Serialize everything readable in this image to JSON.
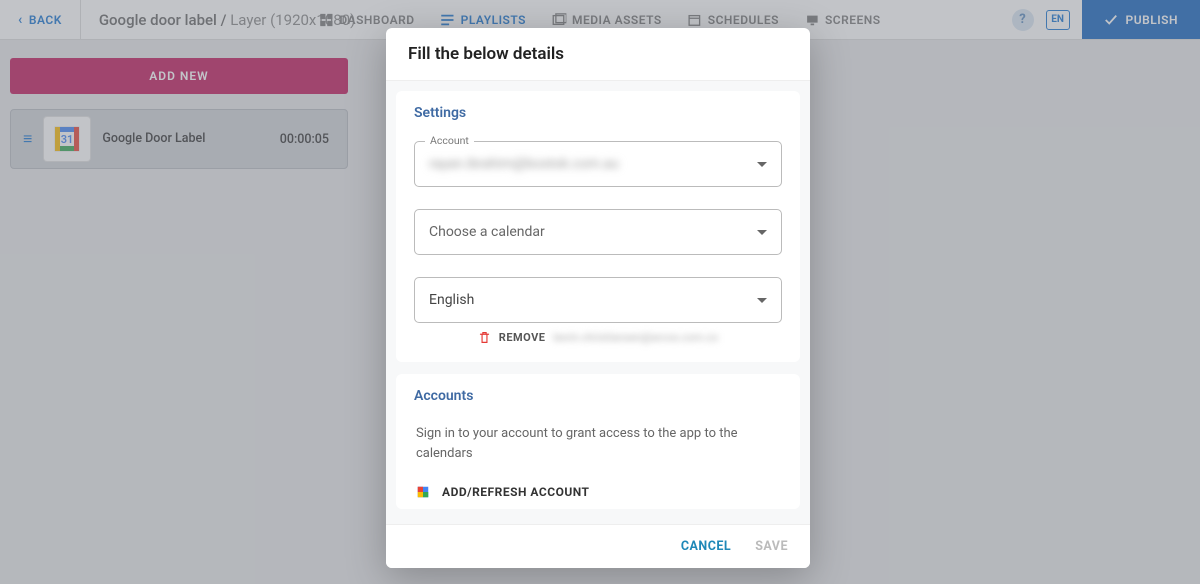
{
  "header": {
    "back": "BACK",
    "title_main": "Google door label /",
    "title_sub": "Layer (1920x1080)",
    "nav": [
      {
        "label": "DASHBOARD"
      },
      {
        "label": "PLAYLISTS"
      },
      {
        "label": "MEDIA ASSETS"
      },
      {
        "label": "SCHEDULES"
      },
      {
        "label": "SCREENS"
      }
    ],
    "lang": "EN",
    "publish": "PUBLISH"
  },
  "left": {
    "add_new": "ADD NEW",
    "item": {
      "name": "Google Door Label",
      "time": "00:00:05"
    }
  },
  "modal": {
    "title": "Fill the below details",
    "settings_title": "Settings",
    "account_label": "Account",
    "account_value": "rayan.ibrahim@bostok.com.au",
    "calendar_placeholder": "Choose a calendar",
    "language_value": "English",
    "remove_label": "REMOVE",
    "remove_email": "kevin.christiansen@arcos.com.co",
    "accounts_title": "Accounts",
    "accounts_text": "Sign in to your account to grant access to the app to the calendars",
    "add_refresh": "ADD/REFRESH ACCOUNT",
    "cancel": "CANCEL",
    "save": "SAVE"
  }
}
